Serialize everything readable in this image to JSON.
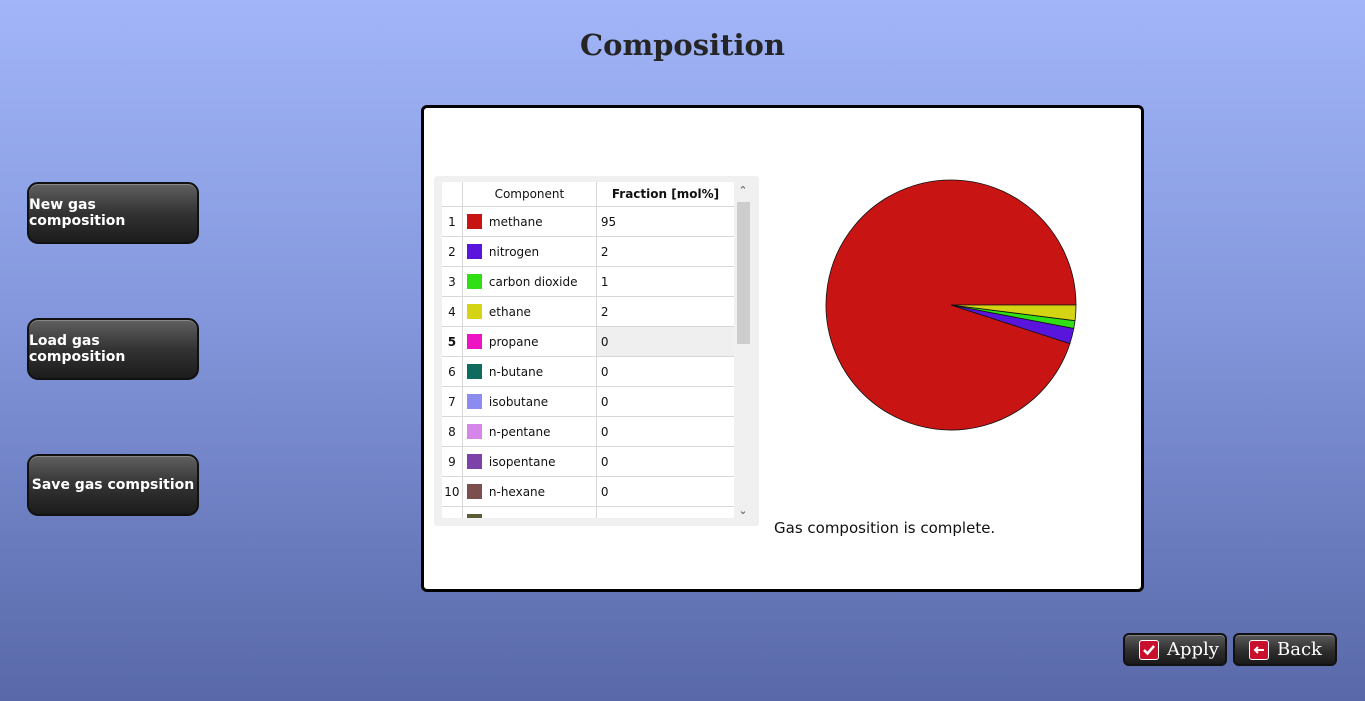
{
  "page": {
    "title": "Composition"
  },
  "sidebar": {
    "new_label": "New gas composition",
    "load_label": "Load gas composition",
    "save_label": "Save gas compsition"
  },
  "table": {
    "headers": {
      "component": "Component",
      "fraction": "Fraction [mol%]"
    },
    "selected_row": 5,
    "rows": [
      {
        "index": "1",
        "name": "methane",
        "value": "95",
        "color": "#c91414"
      },
      {
        "index": "2",
        "name": "nitrogen",
        "value": "2",
        "color": "#5a15dc"
      },
      {
        "index": "3",
        "name": "carbon dioxide",
        "value": "1",
        "color": "#30e014"
      },
      {
        "index": "4",
        "name": "ethane",
        "value": "2",
        "color": "#d4d414"
      },
      {
        "index": "5",
        "name": "propane",
        "value": "0",
        "color": "#ee14c4"
      },
      {
        "index": "6",
        "name": "n-butane",
        "value": "0",
        "color": "#0f6b5e"
      },
      {
        "index": "7",
        "name": "isobutane",
        "value": "0",
        "color": "#8c8cf0"
      },
      {
        "index": "8",
        "name": "n-pentane",
        "value": "0",
        "color": "#d686e8"
      },
      {
        "index": "9",
        "name": "isopentane",
        "value": "0",
        "color": "#7c42aa"
      },
      {
        "index": "10",
        "name": "n-hexane",
        "value": "0",
        "color": "#7c4e4e"
      },
      {
        "index": "",
        "name": "",
        "value": "",
        "color": "#5b5b38"
      }
    ]
  },
  "chart_data": {
    "type": "pie",
    "slices": [
      {
        "label": "methane",
        "value": 95,
        "color": "#c91414"
      },
      {
        "label": "nitrogen",
        "value": 2,
        "color": "#5a15dc"
      },
      {
        "label": "carbon dioxide",
        "value": 1,
        "color": "#30e014"
      },
      {
        "label": "ethane",
        "value": 2,
        "color": "#d4d414"
      }
    ]
  },
  "status": {
    "text": "Gas composition is complete."
  },
  "footer": {
    "apply_label": "Apply",
    "back_label": "Back"
  }
}
